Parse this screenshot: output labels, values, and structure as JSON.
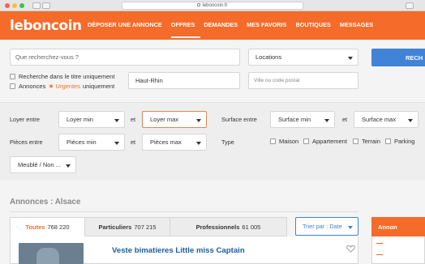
{
  "browser": {
    "url": "leboncoin.fr"
  },
  "header": {
    "logo": "leboncoin",
    "nav": [
      {
        "label": "DÉPOSER UNE ANNONCE",
        "active": false
      },
      {
        "label": "OFFRES",
        "active": true
      },
      {
        "label": "DEMANDES",
        "active": false
      },
      {
        "label": "MES FAVORIS",
        "active": false
      },
      {
        "label": "BOUTIQUES",
        "active": false
      },
      {
        "label": "MESSAGES",
        "active": false
      }
    ]
  },
  "search": {
    "query_placeholder": "Que recherchez-vous ?",
    "category": "Locations",
    "button_label": "RECH",
    "region": "Haut-Rhin",
    "city_placeholder": "Ville ou code postal",
    "opt_title_only": "Recherche dans le titre uniquement",
    "opt_urgent_pre": "Annonces",
    "opt_urgent_word": "Urgentes",
    "opt_urgent_post": "uniquement"
  },
  "filters": {
    "loyer_label": "Loyer entre",
    "loyer_min": "Loyer min",
    "et": "et",
    "loyer_max": "Loyer max",
    "surface_label": "Surface entre",
    "surface_min": "Surface min",
    "surface_max": "Surface max",
    "pieces_label": "Pièces entre",
    "pieces_min": "Pièces min",
    "pieces_max": "Pièces max",
    "type_label": "Type",
    "types": [
      "Maison",
      "Appartement",
      "Terrain",
      "Parking"
    ],
    "meuble": "Meublé / Non ..."
  },
  "results": {
    "title": "Annonces : Alsace",
    "tabs": [
      {
        "name": "Toutes",
        "count": "768 220",
        "active": true
      },
      {
        "name": "Particuliers",
        "count": "707 215",
        "active": false
      },
      {
        "name": "Professionnels",
        "count": "61 005",
        "active": false
      }
    ],
    "sort_label": "Trier par : Date",
    "item_title": "Veste bimatieres Little miss Captain",
    "side_title": "Annon"
  },
  "colors": {
    "brand": "#f56b2a",
    "link": "#1a5d9e",
    "button": "#4183d7"
  }
}
